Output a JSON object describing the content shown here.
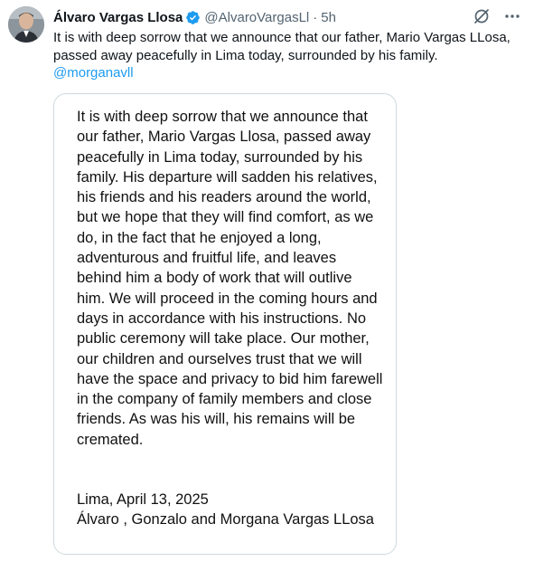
{
  "tweet": {
    "author_name": "Álvaro Vargas Llosa",
    "handle": "@AlvaroVargasLl",
    "separator": "·",
    "timestamp": "5h",
    "text": "It is with deep sorrow that we announce that our father, Mario Vargas LLosa, passed away peacefully in Lima today, surrounded by his family.",
    "mention": "@morganavll",
    "verified_color": "#1d9bf0",
    "link_color": "#1d9bf0",
    "icons": [
      "grok-icon",
      "more-icon",
      "verified-badge-icon"
    ]
  },
  "media": {
    "statement": "It is with deep sorrow that we announce that our father, Mario Vargas Llosa, passed away peacefully in Lima today, surrounded by his family. His departure will sadden his relatives, his friends and his readers around the world, but we hope that they will find comfort, as we do, in the fact that he enjoyed a long, adventurous and fruitful life, and leaves behind him a body of work that will outlive him. We will proceed in the coming hours and days in accordance with his instructions. No public ceremony will take place. Our mother, our children and ourselves trust that we will have the space and privacy to bid him farewell in the company of family members and close friends. As was his will, his remains will be cremated.",
    "place_date": "Lima, April 13, 2025",
    "signatories": "Álvaro , Gonzalo and Morgana Vargas LLosa"
  }
}
